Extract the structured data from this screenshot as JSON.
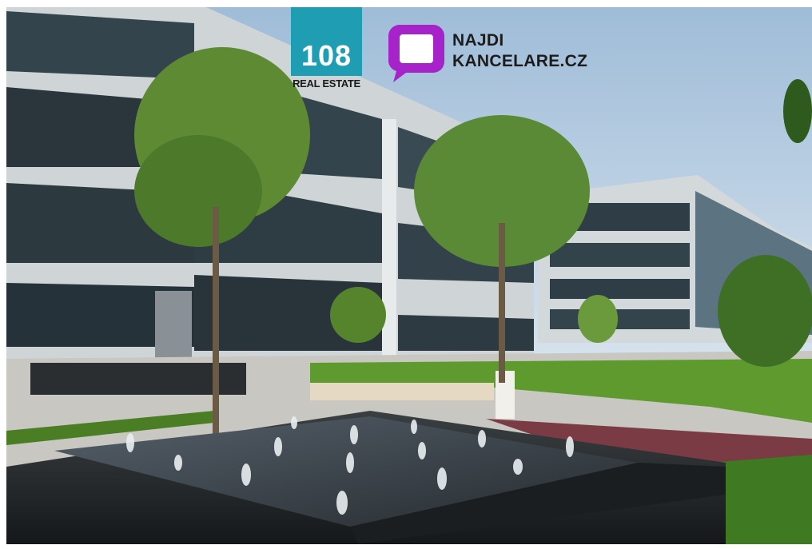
{
  "photo": {
    "subject": "office-campus-courtyard-with-fountain",
    "colors": {
      "sky": "#b9cfe4",
      "facade": "#cfd4d6",
      "glass": "#2c3a40",
      "grass": "#5e9a2e",
      "granite": "#1f2224"
    }
  },
  "logos": {
    "real_estate": {
      "number": "108",
      "caption": "REAL ESTATE",
      "color": "#1f9db3"
    },
    "portal": {
      "line1": "NAJDI",
      "line2": "KANCELARE.CZ",
      "color": "#a523c9"
    }
  }
}
